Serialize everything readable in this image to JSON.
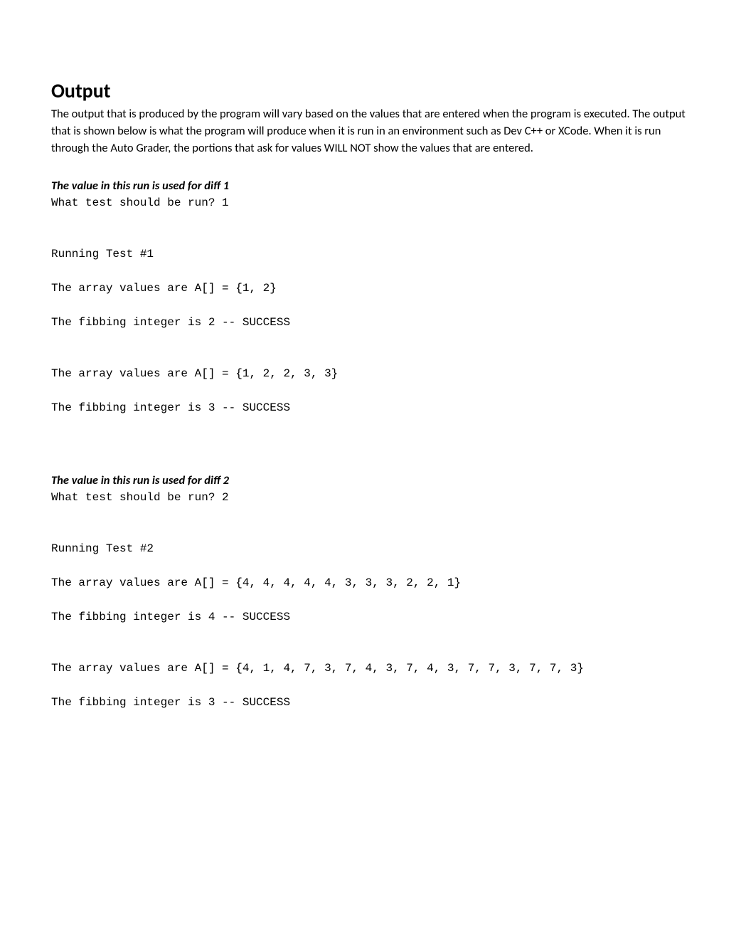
{
  "heading": "Output",
  "intro": "The output that is produced by the program will vary based on the values that are entered when the program is executed. The output that is shown below is what the program will produce when it is run in an environment such as Dev C++ or XCode. When it is run through the Auto Grader, the portions that ask for values WILL NOT show the values that are entered.",
  "run1": {
    "label": "The value in this run is used for diff 1",
    "output": "What test should be run? 1\n\n\nRunning Test #1\n\nThe array values are A[] = {1, 2}\n\nThe fibbing integer is 2 -- SUCCESS\n\n\nThe array values are A[] = {1, 2, 2, 3, 3}\n\nThe fibbing integer is 3 -- SUCCESS"
  },
  "run2": {
    "label": "The value in this run is used for diff 2",
    "output": "What test should be run? 2\n\n\nRunning Test #2\n\nThe array values are A[] = {4, 4, 4, 4, 4, 3, 3, 3, 2, 2, 1}\n\nThe fibbing integer is 4 -- SUCCESS\n\n\nThe array values are A[] = {4, 1, 4, 7, 3, 7, 4, 3, 7, 4, 3, 7, 7, 3, 7, 7, 3}\n\nThe fibbing integer is 3 -- SUCCESS"
  }
}
